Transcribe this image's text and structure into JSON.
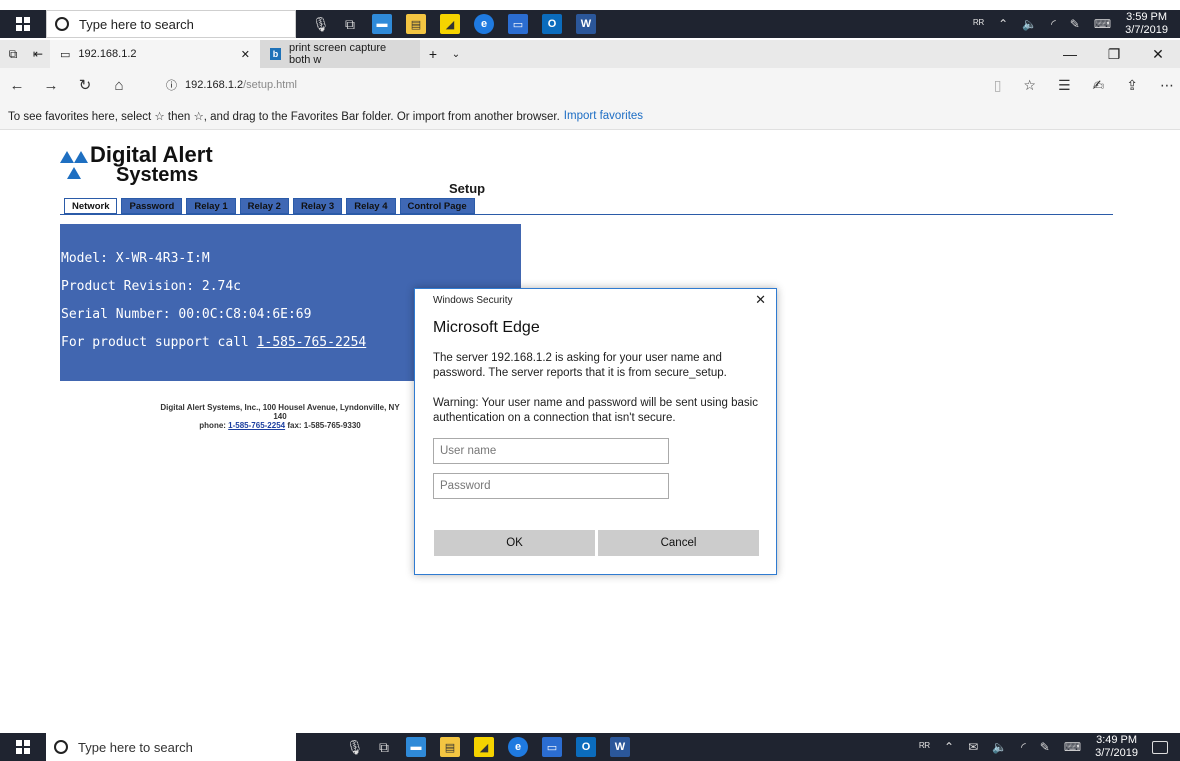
{
  "taskbar": {
    "search_placeholder": "Type here to search",
    "time_top": "3:59 PM",
    "date_top": "3/7/2019",
    "time_bottom": "3:49 PM",
    "date_bottom": "3/7/2019"
  },
  "browser": {
    "tab_active": "192.168.1.2",
    "tab_inactive": "print screen capture both w",
    "url_host": "192.168.1.2",
    "url_path": "/setup.html",
    "favbar_text": "To see favorites here, select ☆ then ☆, and drag to the Favorites Bar folder. Or import from another browser.",
    "favbar_link": "Import favorites"
  },
  "page": {
    "logo_line1": "Digital Alert",
    "logo_line2": "Systems",
    "setup_title": "Setup",
    "tabs": [
      "Network",
      "Password",
      "Relay 1",
      "Relay 2",
      "Relay 3",
      "Relay 4",
      "Control Page"
    ],
    "model": "Model: X-WR-4R3-I:M",
    "revision": "Product Revision: 2.74c",
    "serial": "Serial Number: 00:0C:C8:04:6E:69",
    "support_prefix": "For product support call ",
    "support_phone": "1-585-765-2254",
    "footer_line1": "Digital Alert Systems, Inc., 100 Housel Avenue, Lyndonville, NY 140",
    "footer_phone_label": "phone: ",
    "footer_phone": "1-585-765-2254",
    "footer_fax": " fax: 1-585-765-9330"
  },
  "dialog": {
    "header": "Windows Security",
    "title": "Microsoft Edge",
    "message": "The server 192.168.1.2 is asking for your user name and password. The server reports that it is from secure_setup.",
    "warning": "Warning: Your user name and password will be sent using basic authentication on a connection that isn't secure.",
    "username_placeholder": "User name",
    "password_placeholder": "Password",
    "ok_label": "OK",
    "cancel_label": "Cancel"
  }
}
